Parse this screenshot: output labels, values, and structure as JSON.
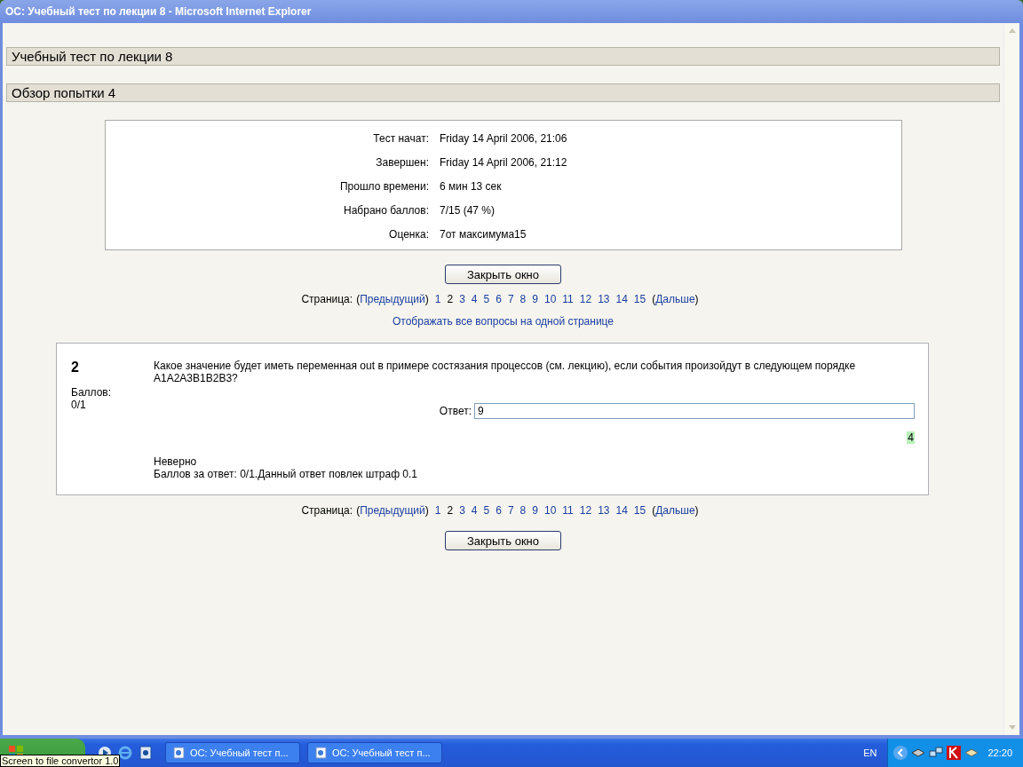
{
  "window": {
    "title": "ОС: Учебный тест по лекции 8 - Microsoft Internet Explorer"
  },
  "headings": [
    "Учебный тест по лекции 8",
    "Обзор попытки 4"
  ],
  "summary": [
    {
      "label": "Тест начат:",
      "value": "Friday 14 April 2006, 21:06"
    },
    {
      "label": "Завершен:",
      "value": "Friday 14 April 2006, 21:12"
    },
    {
      "label": "Прошло времени:",
      "value": "6 мин 13 сек"
    },
    {
      "label": "Набрано баллов:",
      "value": "7/15 (47 %)"
    },
    {
      "label": "Оценка:",
      "value": "7от максимума15"
    }
  ],
  "close_button": "Закрыть окно",
  "pager_top": {
    "label": "Страница:",
    "open": "(",
    "close": ")",
    "prev": "Предыдущий",
    "next": "Дальше",
    "pages": [
      {
        "label": "1",
        "selected": false
      },
      {
        "label": "2",
        "selected": true
      },
      {
        "label": "3",
        "selected": false
      },
      {
        "label": "4",
        "selected": false
      },
      {
        "label": "5",
        "selected": false
      },
      {
        "label": "6",
        "selected": false
      },
      {
        "label": "7",
        "selected": false
      },
      {
        "label": "8",
        "selected": false
      },
      {
        "label": "9",
        "selected": false
      },
      {
        "label": "10",
        "selected": false
      },
      {
        "label": "11",
        "selected": false
      },
      {
        "label": "12",
        "selected": false
      },
      {
        "label": "13",
        "selected": false
      },
      {
        "label": "14",
        "selected": false
      },
      {
        "label": "15",
        "selected": false
      }
    ]
  },
  "show_all_link": "Отображать все вопросы на одной странице",
  "question": {
    "number": "2",
    "points_label": "Баллов:",
    "points": "0/1",
    "text": "Какое значение будет иметь переменная out в примере состязания процессов (см. лекцию), если события произойдут в следующем порядке A1A2A3B1B2B3?",
    "answer_label": "Ответ:",
    "answer_value": "9",
    "correct_answer": "4",
    "verdict": "Неверно",
    "feedback": "Баллов за ответ: 0/1.Данный ответ повлек штраф 0.1"
  },
  "pager_bottom": {
    "label": "Страница:",
    "open": "(",
    "close": ")",
    "prev": "Предыдущий",
    "next": "Дальше",
    "pages": [
      {
        "label": "1",
        "selected": false
      },
      {
        "label": "2",
        "selected": true
      },
      {
        "label": "3",
        "selected": false
      },
      {
        "label": "4",
        "selected": false
      },
      {
        "label": "5",
        "selected": false
      },
      {
        "label": "6",
        "selected": false
      },
      {
        "label": "7",
        "selected": false
      },
      {
        "label": "8",
        "selected": false
      },
      {
        "label": "9",
        "selected": false
      },
      {
        "label": "10",
        "selected": false
      },
      {
        "label": "11",
        "selected": false
      },
      {
        "label": "12",
        "selected": false
      },
      {
        "label": "13",
        "selected": false
      },
      {
        "label": "14",
        "selected": false
      },
      {
        "label": "15",
        "selected": false
      }
    ]
  },
  "close_button_bottom": "Закрыть окно",
  "taskbar": {
    "tooltip": "Screen to file convertor 1.0",
    "tasks": [
      "ОС: Учебный тест п...",
      "ОС: Учебный тест п..."
    ],
    "language": "EN",
    "clock": "22:20"
  }
}
